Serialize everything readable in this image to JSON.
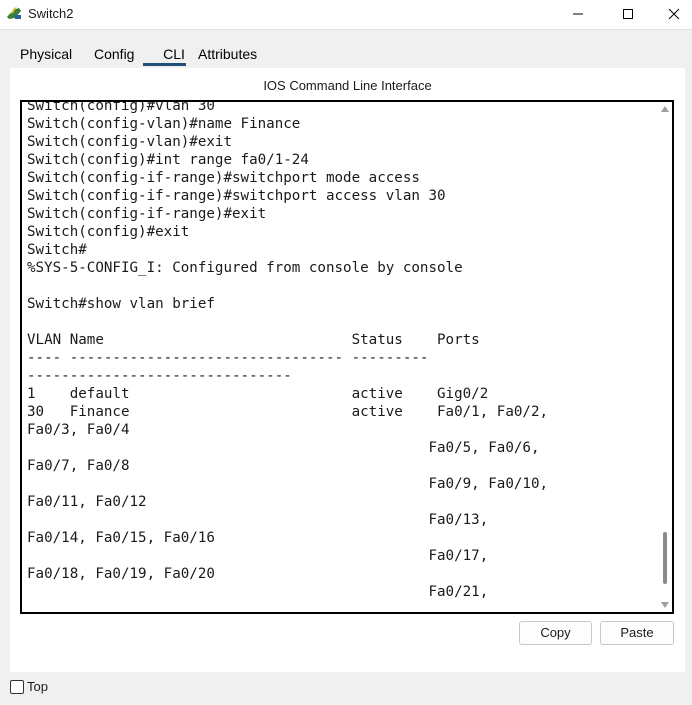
{
  "window": {
    "title": "Switch2",
    "icon": "switch-app-icon"
  },
  "tabs": [
    {
      "label": "Physical"
    },
    {
      "label": "Config"
    },
    {
      "label": "CLI",
      "active": true
    },
    {
      "label": "Attributes"
    }
  ],
  "cli": {
    "heading": "IOS Command Line Interface",
    "lines": [
      "Switch(config)#vlan 30",
      "Switch(config-vlan)#name Finance",
      "Switch(config-vlan)#exit",
      "Switch(config)#int range fa0/1-24",
      "Switch(config-if-range)#switchport mode access",
      "Switch(config-if-range)#switchport access vlan 30",
      "Switch(config-if-range)#exit",
      "Switch(config)#exit",
      "Switch#",
      "%SYS-5-CONFIG_I: Configured from console by console",
      "",
      "Switch#show vlan brief",
      "",
      "VLAN Name                             Status    Ports",
      "---- -------------------------------- ---------",
      "-------------------------------",
      "1    default                          active    Gig0/2",
      "30   Finance                          active    Fa0/1, Fa0/2,",
      "Fa0/3, Fa0/4",
      "                                               Fa0/5, Fa0/6,",
      "Fa0/7, Fa0/8",
      "                                               Fa0/9, Fa0/10,",
      "Fa0/11, Fa0/12",
      "                                               Fa0/13,",
      "Fa0/14, Fa0/15, Fa0/16",
      "                                               Fa0/17,",
      "Fa0/18, Fa0/19, Fa0/20",
      "                                               Fa0/21,"
    ]
  },
  "buttons": {
    "copy": "Copy",
    "paste": "Paste"
  },
  "footer": {
    "top_label": "Top",
    "top_checked": false
  },
  "colors": {
    "active_tab_underline": "#1f4e79",
    "terminal_border": "#000000"
  }
}
